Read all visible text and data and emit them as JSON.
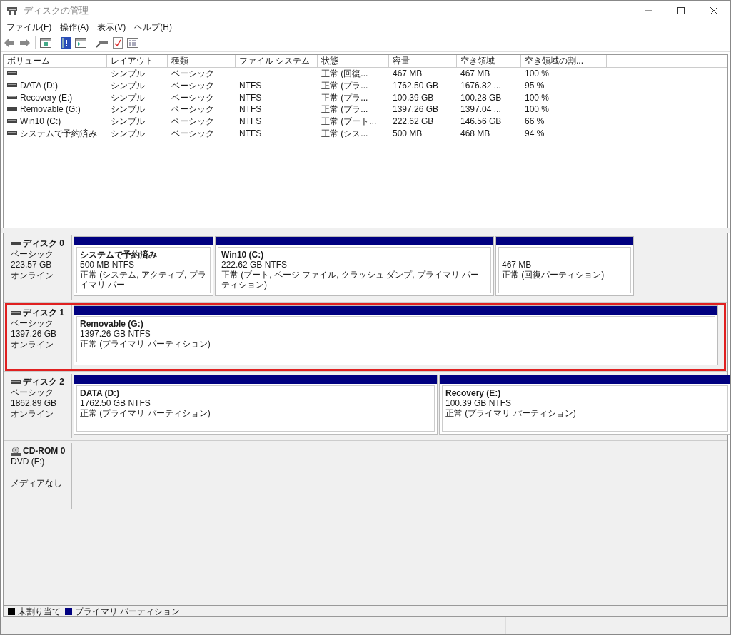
{
  "window": {
    "title": "ディスクの管理"
  },
  "menu": [
    "ファイル(F)",
    "操作(A)",
    "表示(V)",
    "ヘルプ(H)"
  ],
  "table": {
    "columns": [
      "ボリューム",
      "レイアウト",
      "種類",
      "ファイル システム",
      "状態",
      "容量",
      "空き領域",
      "空き領域の割..."
    ],
    "rows": [
      [
        "",
        "シンプル",
        "ベーシック",
        "",
        "正常 (回復...",
        "467 MB",
        "467 MB",
        "100 %"
      ],
      [
        "DATA (D:)",
        "シンプル",
        "ベーシック",
        "NTFS",
        "正常 (プラ...",
        "1762.50 GB",
        "1676.82 ...",
        "95 %"
      ],
      [
        "Recovery (E:)",
        "シンプル",
        "ベーシック",
        "NTFS",
        "正常 (プラ...",
        "100.39 GB",
        "100.28 GB",
        "100 %"
      ],
      [
        "Removable (G:)",
        "シンプル",
        "ベーシック",
        "NTFS",
        "正常 (プラ...",
        "1397.26 GB",
        "1397.04 ...",
        "100 %"
      ],
      [
        "Win10 (C:)",
        "シンプル",
        "ベーシック",
        "NTFS",
        "正常 (ブート...",
        "222.62 GB",
        "146.56 GB",
        "66 %"
      ],
      [
        "システムで予約済み",
        "シンプル",
        "ベーシック",
        "NTFS",
        "正常 (シス...",
        "500 MB",
        "468 MB",
        "94 %"
      ]
    ]
  },
  "disks": [
    {
      "kind": "disk",
      "name": "ディスク 0",
      "type": "ベーシック",
      "size": "223.57 GB",
      "status": "オンライン",
      "highlighted": false,
      "partitions": [
        {
          "name": "システムで予約済み",
          "size": "500 MB NTFS",
          "status": "正常 (システム, アクティブ, プライマリ パー"
        },
        {
          "name": "Win10  (C:)",
          "size": "222.62 GB NTFS",
          "status": "正常 (ブート, ページ ファイル, クラッシュ ダンプ, プライマリ パーティション)"
        },
        {
          "size": "467 MB",
          "status": "正常 (回復パーティション)"
        }
      ]
    },
    {
      "kind": "disk",
      "name": "ディスク 1",
      "type": "ベーシック",
      "size": "1397.26 GB",
      "status": "オンライン",
      "highlighted": true,
      "partitions": [
        {
          "name": "Removable  (G:)",
          "size": "1397.26 GB NTFS",
          "status": "正常 (プライマリ パーティション)"
        }
      ]
    },
    {
      "kind": "disk",
      "name": "ディスク 2",
      "type": "ベーシック",
      "size": "1862.89 GB",
      "status": "オンライン",
      "highlighted": false,
      "partitions": [
        {
          "name": "DATA  (D:)",
          "size": "1762.50 GB NTFS",
          "status": "正常 (プライマリ パーティション)"
        },
        {
          "name": "Recovery  (E:)",
          "size": "100.39 GB NTFS",
          "status": "正常 (プライマリ パーティション)"
        }
      ]
    },
    {
      "kind": "cdrom",
      "name": "CD-ROM 0",
      "type": "DVD (F:)",
      "status": "メディアなし",
      "highlighted": false
    }
  ],
  "legend": [
    {
      "label": "未割り当て",
      "color": "#000000"
    },
    {
      "label": "プライマリ パーティション",
      "color": "#000080"
    }
  ]
}
